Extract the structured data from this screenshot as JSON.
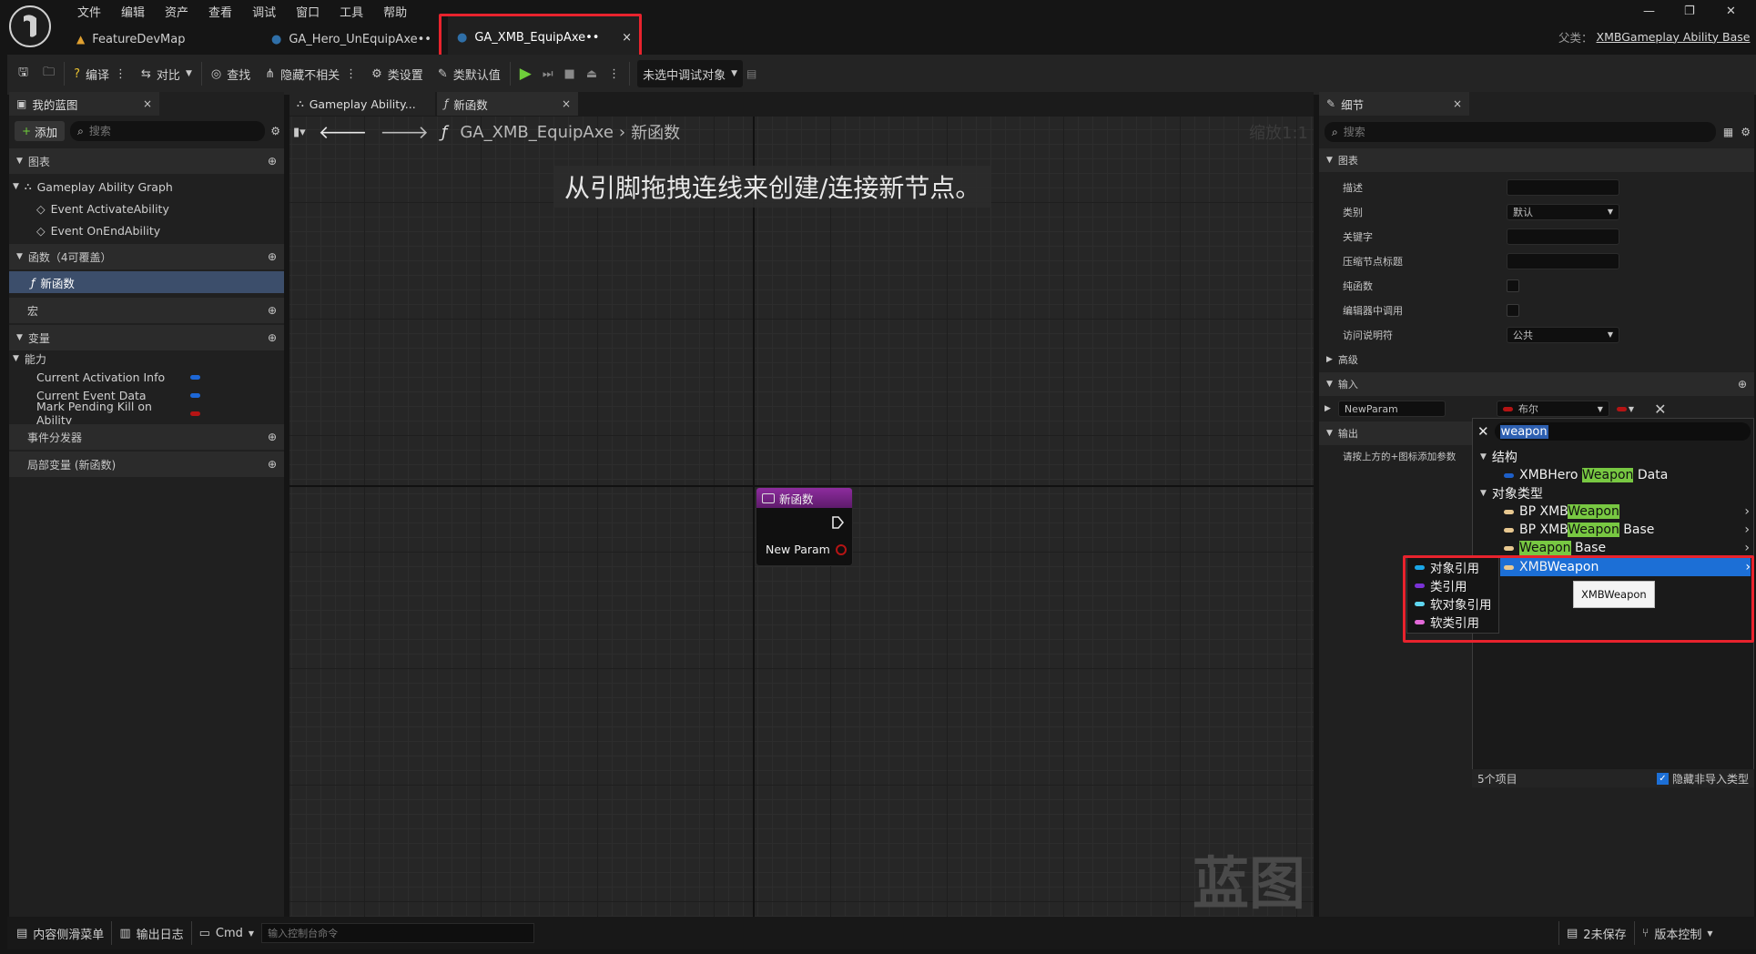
{
  "menu": [
    "文件",
    "编辑",
    "资产",
    "查看",
    "调试",
    "窗口",
    "工具",
    "帮助"
  ],
  "tabs": [
    {
      "label": "FeatureDevMap"
    },
    {
      "label": "GA_Hero_UnEquipAxe••"
    },
    {
      "label": "GA_XMB_EquipAxe••"
    }
  ],
  "parent_class": {
    "label": "父类：",
    "value": "XMBGameplay Ability Base"
  },
  "toolbar": {
    "compile": "编译",
    "diff": "对比",
    "find": "查找",
    "hide_unrelated": "隐藏不相关",
    "class_settings": "类设置",
    "class_defaults": "类默认值",
    "debug_target": "未选中调试对象"
  },
  "my_blueprint": {
    "tab": "我的蓝图",
    "add": "添加",
    "search_placeholder": "搜索",
    "graphs_section": "图表",
    "graph_name": "Gameplay Ability Graph",
    "events": [
      "Event ActivateAbility",
      "Event OnEndAbility"
    ],
    "functions_section": "函数（4可覆盖）",
    "function_selected": "新函数",
    "macros_section": "宏",
    "variables_section": "变量",
    "category_ability": "能力",
    "variables": [
      {
        "name": "Current Activation Info",
        "color": "#1d67d6"
      },
      {
        "name": "Current Event Data",
        "color": "#1d67d6"
      },
      {
        "name": "Mark Pending Kill on Ability",
        "color": "#b51414"
      }
    ],
    "dispatchers_section": "事件分发器",
    "locals_section": "局部变量 (新函数)"
  },
  "graph": {
    "tabs": [
      "Gameplay Ability...",
      "新函数"
    ],
    "breadcrumb_root": "GA_XMB_EquipAxe",
    "breadcrumb_current": "新函数",
    "zoom": "缩放1:1",
    "hint": "从引脚拖拽连线来创建/连接新节点。",
    "node_title": "新函数",
    "node_pin": "New Param",
    "watermark": "蓝图"
  },
  "details": {
    "tab": "细节",
    "search_placeholder": "搜索",
    "graph_section": "图表",
    "rows": [
      "描述",
      "类别",
      "关键字",
      "压缩节点标题",
      "纯函数",
      "编辑器中调用",
      "访问说明符"
    ],
    "category_value": "默认",
    "access_value": "公共",
    "advanced": "高级",
    "inputs_section": "输入",
    "param_name": "NewParam",
    "param_type": "布尔",
    "outputs_section": "输出",
    "outputs_hint": "请按上方的+图标添加参数"
  },
  "type_picker": {
    "search_value": "weapon",
    "cat_struct": "结构",
    "struct_item_pre": "XMBHero ",
    "struct_item_hl": "Weapon",
    "struct_item_post": " Data",
    "cat_object": "对象类型",
    "items": [
      {
        "pre": "BP XMB",
        "hl": "Weapon",
        "post": ""
      },
      {
        "pre": "BP XMB",
        "hl": "Weapon",
        "post": " Base"
      },
      {
        "pre": "",
        "hl": "Weapon",
        "post": " Base"
      },
      {
        "pre": "XMB",
        "hl": "Weapon",
        "post": ""
      }
    ],
    "count": "5个项目",
    "hide_non_imported": "隐藏非导入类型",
    "tooltip": "XMBWeapon",
    "ref_types": [
      {
        "label": "对象引用",
        "color": "#1aa7e8"
      },
      {
        "label": "类引用",
        "color": "#7a32d6"
      },
      {
        "label": "软对象引用",
        "color": "#5fd6f0"
      },
      {
        "label": "软类引用",
        "color": "#e36ad9"
      }
    ]
  },
  "statusbar": {
    "content_drawer": "内容侧滑菜单",
    "output_log": "输出日志",
    "cmd": "Cmd",
    "console_placeholder": "输入控制台命令",
    "unsaved": "2未保存",
    "source_control": "版本控制"
  }
}
